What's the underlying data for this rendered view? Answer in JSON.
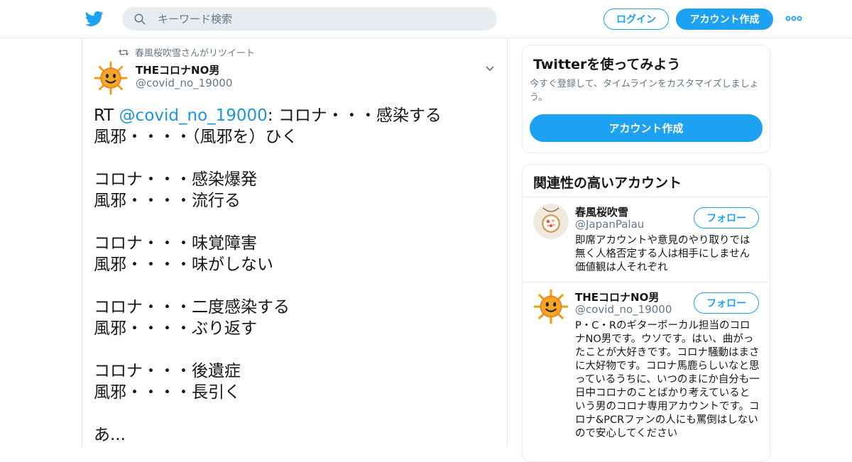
{
  "header": {
    "logo_icon": "twitter-bird-icon",
    "search_placeholder": "キーワード検索",
    "login_label": "ログイン",
    "signup_label": "アカウント作成",
    "more_icon": "more-dots-icon",
    "brand_color": "#1da1f2"
  },
  "tweet": {
    "retweet_context": "春風桜吹雪さんがリツイート",
    "author_name": "THEコロナNO男",
    "author_handle": "@covid_no_19000",
    "text_prefix": "RT ",
    "mention": "@covid_no_19000",
    "text_body": ": コロナ・・・感染する\n風邪・・・・（風邪を）ひく\n\nコロナ・・・感染爆発\n風邪・・・・流行る\n\nコロナ・・・味覚障害\n風邪・・・・味がしない\n\nコロナ・・・二度感染する\n風邪・・・・ぶり返す\n\nコロナ・・・後遺症\n風邪・・・・長引く\n\nあ..."
  },
  "try_card": {
    "title": "Twitterを使ってみよう",
    "description": "今すぐ登録して、タイムラインをカスタマイズしましょう。",
    "button_label": "アカウント作成"
  },
  "related": {
    "title": "関連性の高いアカウント",
    "accounts": [
      {
        "name": "春風桜吹雪",
        "handle": "@JapanPalau",
        "follow_label": "フォロー",
        "bio": "即席アカウントや意見のやり取りでは無く人格否定する人は相手にしません価値観は人それぞれ"
      },
      {
        "name": "THEコロナNO男",
        "handle": "@covid_no_19000",
        "follow_label": "フォロー",
        "bio": "P・C・Rのギターボーカル担当のコロナNO男です。ウソです。はい、曲がったことが大好きです。コロナ騒動はまさに大好物です。コロナ馬鹿らしいなと思っているうちに、いつのまにか自分も一日中コロナのことばかり考えているという男のコロナ専用アカウントです。コロナ&PCRファンの人にも罵倒はしないので安心してください"
      }
    ]
  }
}
